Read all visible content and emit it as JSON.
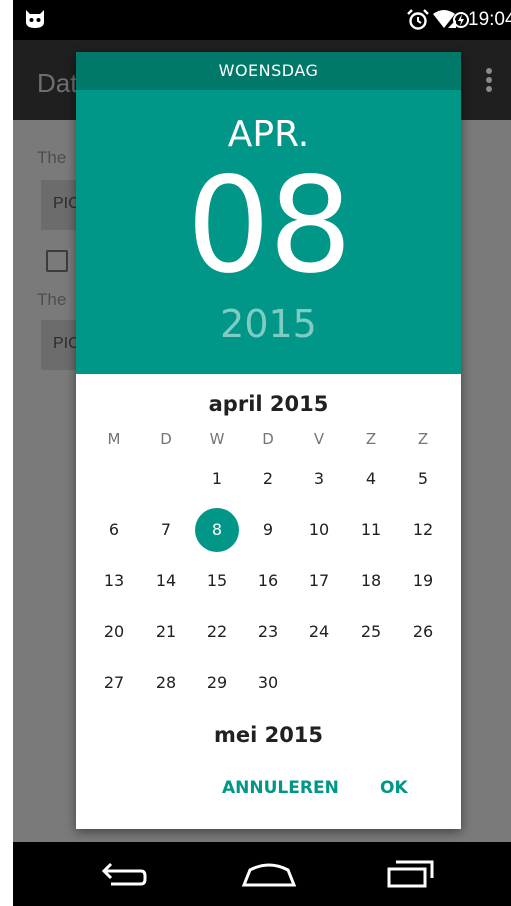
{
  "status_bar": {
    "time": "19:04"
  },
  "app": {
    "title": "Dat",
    "text1": "The",
    "button1": "PIC",
    "text2": "The",
    "button2": "PIC"
  },
  "dialog": {
    "weekday_header": "WOENSDAG",
    "month_short": "APR.",
    "day": "08",
    "year": "2015",
    "month_title": "april 2015",
    "weekdays": [
      "M",
      "D",
      "W",
      "D",
      "V",
      "Z",
      "Z"
    ],
    "weeks": [
      [
        "",
        "",
        "1",
        "2",
        "3",
        "4",
        "5"
      ],
      [
        "6",
        "7",
        "8",
        "9",
        "10",
        "11",
        "12"
      ],
      [
        "13",
        "14",
        "15",
        "16",
        "17",
        "18",
        "19"
      ],
      [
        "20",
        "21",
        "22",
        "23",
        "24",
        "25",
        "26"
      ],
      [
        "27",
        "28",
        "29",
        "30",
        "",
        "",
        ""
      ]
    ],
    "selected_day": "8",
    "next_month_title": "mei 2015",
    "cancel_label": "ANNULEREN",
    "ok_label": "OK"
  },
  "colors": {
    "accent": "#009688",
    "accent_dark": "#00796b",
    "year_faded": "#80cbc4"
  }
}
